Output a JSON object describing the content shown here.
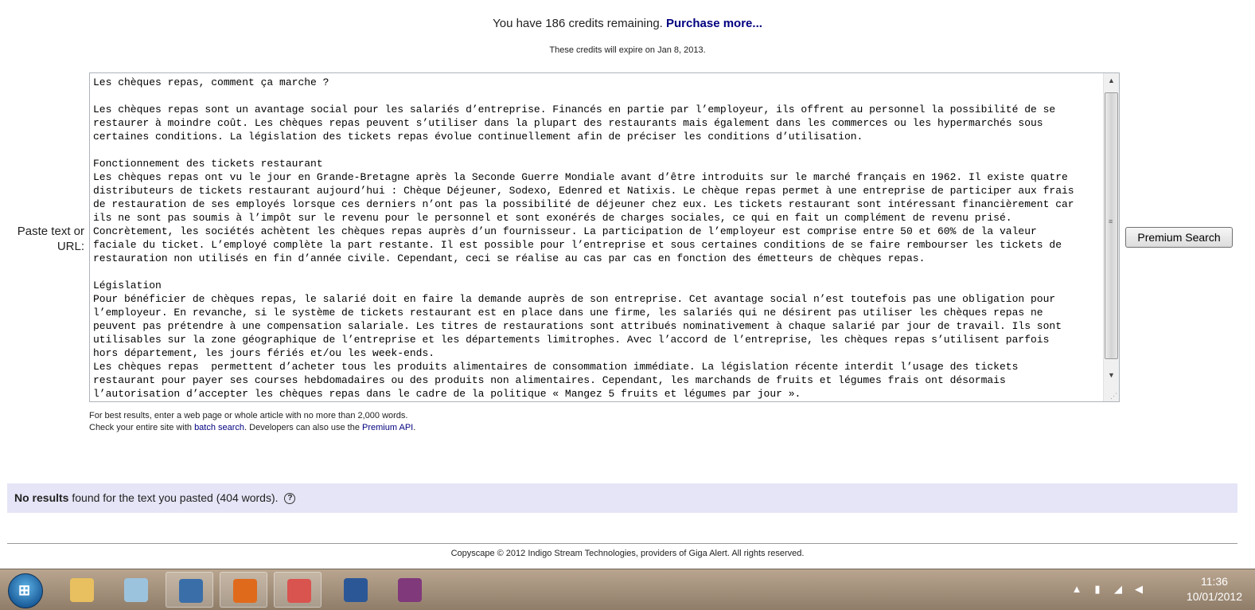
{
  "credits": {
    "prefix": "You have 186 credits remaining.",
    "purchase_link": "Purchase more...",
    "expiry": "These credits will expire on Jan 8, 2013."
  },
  "search": {
    "label": "Paste text or URL:",
    "text": "Les chèques repas, comment ça marche ?\n\nLes chèques repas sont un avantage social pour les salariés d’entreprise. Financés en partie par l’employeur, ils offrent au personnel la possibilité de se\nrestaurer à moindre coût. Les chèques repas peuvent s’utiliser dans la plupart des restaurants mais également dans les commerces ou les hypermarchés sous\ncertaines conditions. La législation des tickets repas évolue continuellement afin de préciser les conditions d’utilisation.\n\nFonctionnement des tickets restaurant\nLes chèques repas ont vu le jour en Grande-Bretagne après la Seconde Guerre Mondiale avant d’être introduits sur le marché français en 1962. Il existe quatre\ndistributeurs de tickets restaurant aujourd’hui : Chèque Déjeuner, Sodexo, Edenred et Natixis. Le chèque repas permet à une entreprise de participer aux frais\nde restauration de ses employés lorsque ces derniers n’ont pas la possibilité de déjeuner chez eux. Les tickets restaurant sont intéressant financièrement car\nils ne sont pas soumis à l’impôt sur le revenu pour le personnel et sont exonérés de charges sociales, ce qui en fait un complément de revenu prisé.\nConcrètement, les sociétés achètent les chèques repas auprès d’un fournisseur. La participation de l’employeur est comprise entre 50 et 60% de la valeur\nfaciale du ticket. L’employé complète la part restante. Il est possible pour l’entreprise et sous certaines conditions de se faire rembourser les tickets de\nrestauration non utilisés en fin d’année civile. Cependant, ceci se réalise au cas par cas en fonction des émetteurs de chèques repas.\n\nLégislation\nPour bénéficier de chèques repas, le salarié doit en faire la demande auprès de son entreprise. Cet avantage social n’est toutefois pas une obligation pour\nl’employeur. En revanche, si le système de tickets restaurant est en place dans une firme, les salariés qui ne désirent pas utiliser les chèques repas ne\npeuvent pas prétendre à une compensation salariale. Les titres de restaurations sont attribués nominativement à chaque salarié par jour de travail. Ils sont\nutilisables sur la zone géographique de l’entreprise et les départements limitrophes. Avec l’accord de l’entreprise, les chèques repas s’utilisent parfois\nhors département, les jours fériés et/ou les week-ends.\nLes chèques repas  permettent d’acheter tous les produits alimentaires de consommation immédiate. La législation récente interdit l’usage des tickets\nrestaurant pour payer ses courses hebdomadaires ou des produits non alimentaires. Cependant, les marchands de fruits et légumes frais ont désormais\nl’autorisation d’accepter les chèques repas dans le cadre de la politique « Mangez 5 fruits et légumes par jour ».",
    "button_label": "Premium Search"
  },
  "hints": {
    "line1": "For best results, enter a web page or whole article with no more than 2,000 words.",
    "line2_prefix": "Check your entire site with",
    "batch_link": "batch search",
    "line2_middle": ". Developers can also use the",
    "api_link": "Premium API",
    "line2_suffix": "."
  },
  "results": {
    "bold": "No results",
    "rest": "found for the text you pasted (404 words).",
    "help_icon": "?"
  },
  "footer": {
    "text": "Copyscape © 2012 Indigo Stream Technologies, providers of Giga Alert. All rights reserved."
  },
  "taskbar": {
    "apps": [
      {
        "icon": "windows-explorer-icon",
        "color": "#e8c060"
      },
      {
        "icon": "notepad-icon",
        "color": "#9cc3de"
      },
      {
        "icon": "thunderbird-icon",
        "color": "#3a6ea8"
      },
      {
        "icon": "firefox-icon",
        "color": "#e06a1b"
      },
      {
        "icon": "snipping-tool-icon",
        "color": "#d9534f"
      },
      {
        "icon": "word-icon",
        "color": "#2b5797"
      },
      {
        "icon": "onenote-icon",
        "color": "#80397b"
      }
    ],
    "clock_time": "11:36",
    "clock_date": "10/01/2012"
  }
}
